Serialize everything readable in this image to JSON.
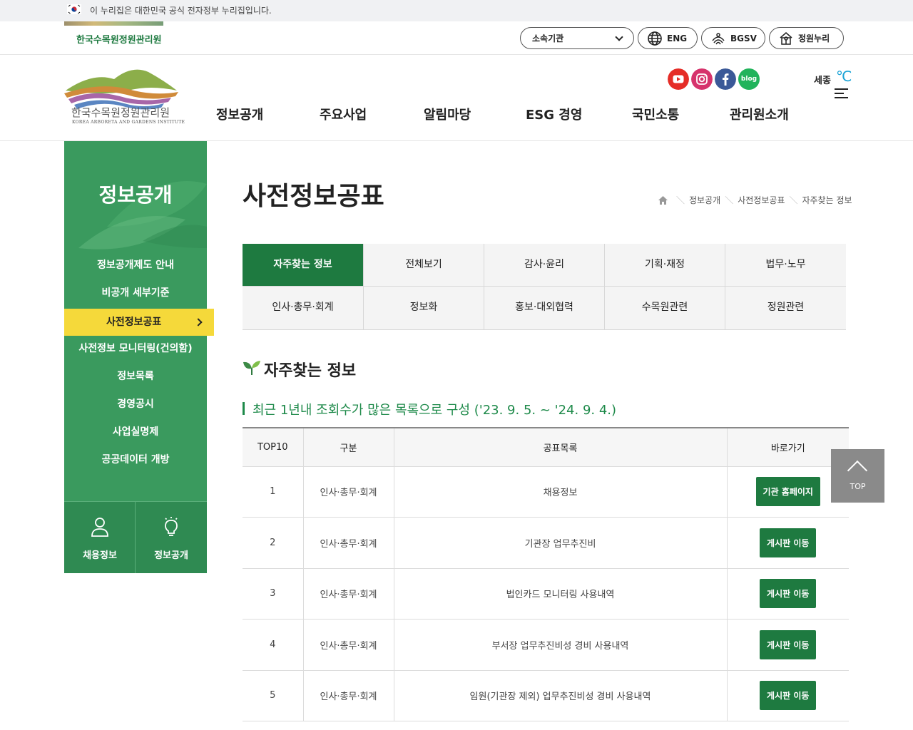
{
  "gov_banner": {
    "text": "이 누리집은 대한민국 공식 전자정부 누리집입니다."
  },
  "utility": {
    "institution": "한국수목원정원관리원",
    "affiliate_select": "소속기관",
    "lang_label": "ENG",
    "bgsv_label": "BGSV",
    "garden_label": "정원누리"
  },
  "logo": {
    "kr": "한국수목원정원관리원",
    "en": "KOREA ARBORETA AND GARDENS INSTITUTE"
  },
  "gnb": [
    "정보공개",
    "주요사업",
    "알림마당",
    "ESG 경영",
    "국민소통",
    "관리원소개"
  ],
  "sns": {
    "blog": "blog"
  },
  "weather": {
    "location": "세종",
    "unit": "℃"
  },
  "lnb": {
    "title": "정보공개",
    "items": [
      "정보공개제도 안내",
      "비공개 세부기준",
      "사전정보공표",
      "사전정보 모니터링(건의함)",
      "정보목록",
      "경영공시",
      "사업실명제",
      "공공데이터 개방"
    ],
    "quick": [
      "채용정보",
      "정보공개"
    ]
  },
  "page": {
    "title": "사전정보공표",
    "breadcrumb": [
      "정보공개",
      "사전정보공표",
      "자주찾는 정보"
    ]
  },
  "tabs": [
    "자주찾는 정보",
    "전체보기",
    "감사·윤리",
    "기획·재정",
    "법무·노무",
    "인사·총무·회계",
    "정보화",
    "홍보·대외협력",
    "수목원관련",
    "정원관련"
  ],
  "section": {
    "title": "자주찾는 정보",
    "subtitle": "최근 1년내 조회수가 많은 목록으로 구성 ('23. 9. 5. ~ '24. 9. 4.)"
  },
  "table": {
    "headers": [
      "TOP10",
      "구분",
      "공표목록",
      "바로가기"
    ],
    "rows": [
      {
        "rank": "1",
        "category": "인사·총무·회계",
        "item": "채용정보",
        "link": "기관 홈페이지"
      },
      {
        "rank": "2",
        "category": "인사·총무·회계",
        "item": "기관장 업무추진비",
        "link": "게시판 이동"
      },
      {
        "rank": "3",
        "category": "인사·총무·회계",
        "item": "법인카드 모니터링 사용내역",
        "link": "게시판 이동"
      },
      {
        "rank": "4",
        "category": "인사·총무·회계",
        "item": "부서장 업무추진비성 경비 사용내역",
        "link": "게시판 이동"
      },
      {
        "rank": "5",
        "category": "인사·총무·회계",
        "item": "임원(기관장 제외) 업무추진비성 경비 사용내역",
        "link": "게시판 이동"
      }
    ]
  },
  "top_button": "TOP",
  "colors": {
    "primary_green": "#1e7a40",
    "lnb_green": "#3a9a5e",
    "active_yellow": "#f5d93a",
    "accent_blue": "#1aa3d6"
  }
}
